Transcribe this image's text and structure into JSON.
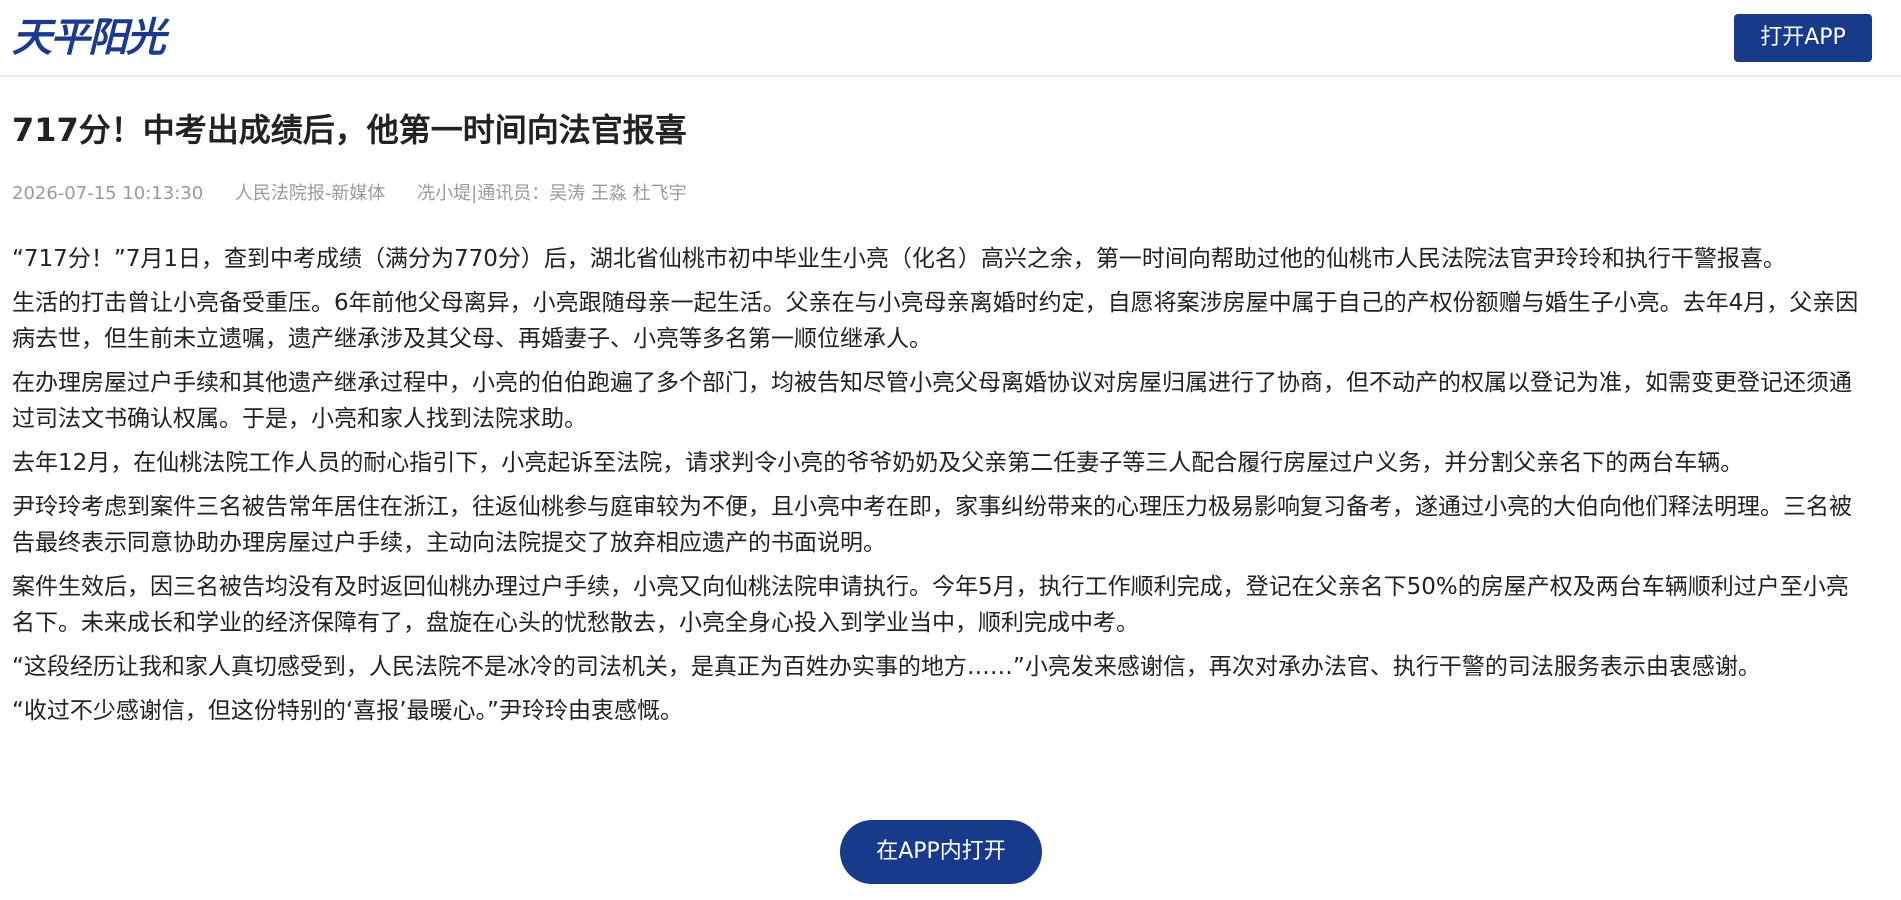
{
  "header": {
    "logo_text": "天平阳光",
    "open_app_label": "打开APP"
  },
  "article": {
    "title": "717分！中考出成绩后，他第一时间向法官报喜",
    "meta": {
      "datetime": "2026-07-15 10:13:30",
      "source": "人民法院报-新媒体",
      "byline": "冼小堤|通讯员：吴涛 王淼 杜飞宇"
    },
    "paragraphs": [
      "“717分！”7月1日，查到中考成绩（满分为770分）后，湖北省仙桃市初中毕业生小亮（化名）高兴之余，第一时间向帮助过他的仙桃市人民法院法官尹玲玲和执行干警报喜。",
      "生活的打击曾让小亮备受重压。6年前他父母离异，小亮跟随母亲一起生活。父亲在与小亮母亲离婚时约定，自愿将案涉房屋中属于自己的产权份额赠与婚生子小亮。去年4月，父亲因病去世，但生前未立遗嘱，遗产继承涉及其父母、再婚妻子、小亮等多名第一顺位继承人。",
      "在办理房屋过户手续和其他遗产继承过程中，小亮的伯伯跑遍了多个部门，均被告知尽管小亮父母离婚协议对房屋归属进行了协商，但不动产的权属以登记为准，如需变更登记还须通过司法文书确认权属。于是，小亮和家人找到法院求助。",
      "去年12月，在仙桃法院工作人员的耐心指引下，小亮起诉至法院，请求判令小亮的爷爷奶奶及父亲第二任妻子等三人配合履行房屋过户义务，并分割父亲名下的两台车辆。",
      "尹玲玲考虑到案件三名被告常年居住在浙江，往返仙桃参与庭审较为不便，且小亮中考在即，家事纠纷带来的心理压力极易影响复习备考，遂通过小亮的大伯向他们释法明理。三名被告最终表示同意协助办理房屋过户手续，主动向法院提交了放弃相应遗产的书面说明。",
      "案件生效后，因三名被告均没有及时返回仙桃办理过户手续，小亮又向仙桃法院申请执行。今年5月，执行工作顺利完成，登记在父亲名下50%的房屋产权及两台车辆顺利过户至小亮名下。未来成长和学业的经济保障有了，盘旋在心头的忧愁散去，小亮全身心投入到学业当中，顺利完成中考。",
      "“这段经历让我和家人真切感受到，人民法院不是冰冷的司法机关，是真正为百姓办实事的地方……”小亮发来感谢信，再次对承办法官、执行干警的司法服务表示由衷感谢。",
      "“收过不少感谢信，但这份特别的‘喜报’最暖心。”尹玲玲由衷感慨。"
    ]
  },
  "footer": {
    "open_in_app_label": "在APP内打开"
  },
  "colors": {
    "brand": "#173a8a",
    "meta_text": "#9a9a9a",
    "body_text": "#222222"
  }
}
